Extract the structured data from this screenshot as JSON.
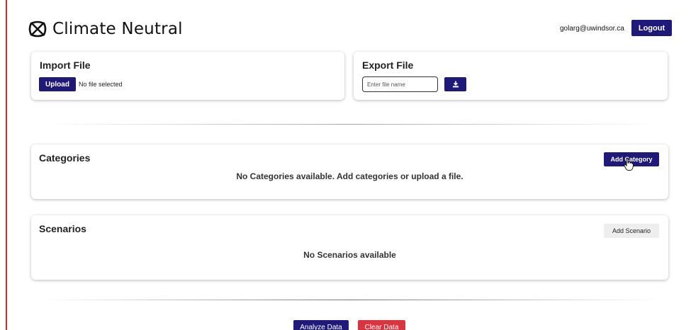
{
  "header": {
    "app_title": "Climate Neutral",
    "logo_icon": "climate-neutral-knot-icon",
    "user_email": "golarg@uwindsor.ca",
    "logout_label": "Logout"
  },
  "import_file": {
    "title": "Import File",
    "upload_label": "Upload",
    "file_status": "No file selected"
  },
  "export_file": {
    "title": "Export File",
    "filename_placeholder": "Enter file name",
    "filename_value": "",
    "download_icon": "download-icon"
  },
  "categories": {
    "title": "Categories",
    "add_label": "Add Category",
    "empty_message": "No Categories available. Add categories or upload a file."
  },
  "scenarios": {
    "title": "Scenarios",
    "add_label": "Add Scenario",
    "empty_message": "No Scenarios available"
  },
  "actions": {
    "analyze_label": "Analyze Data",
    "clear_label": "Clear Data"
  },
  "colors": {
    "primary": "#1f1a7a",
    "danger": "#d9343f",
    "left_accent": "#c62c2c",
    "secondary_button": "#eeeeee"
  }
}
